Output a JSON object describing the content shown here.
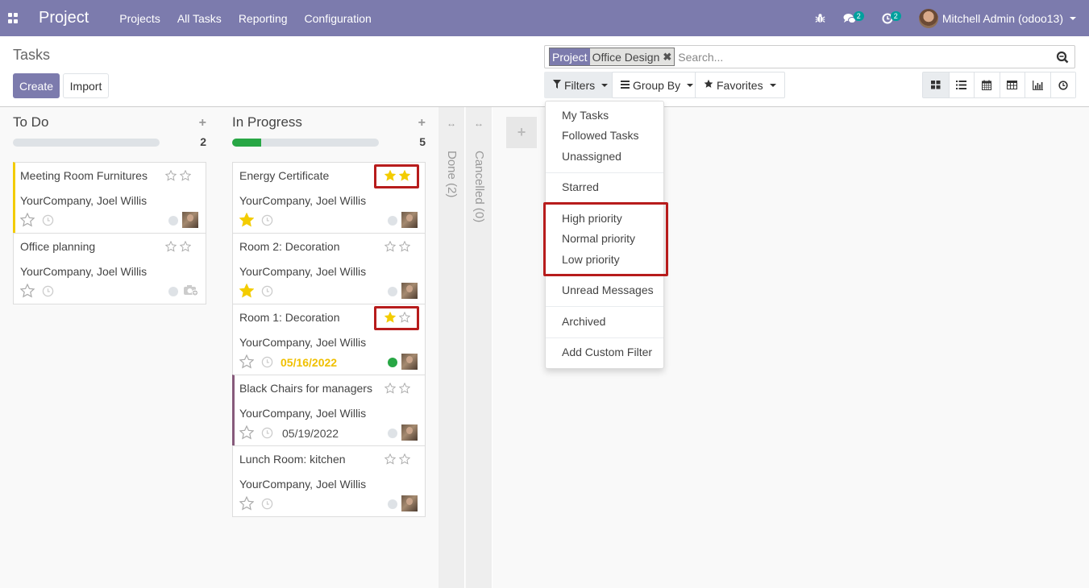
{
  "navbar": {
    "app_name": "Project",
    "menu": [
      "Projects",
      "All Tasks",
      "Reporting",
      "Configuration"
    ],
    "messages_count": "2",
    "activities_count": "2",
    "user": "Mitchell Admin (odoo13)"
  },
  "control": {
    "title": "Tasks",
    "create_label": "Create",
    "import_label": "Import",
    "search": {
      "facet_category": "Project",
      "facet_value": "Office Design",
      "placeholder": "Search..."
    },
    "filters_label": "Filters",
    "groupby_label": "Group By",
    "favorites_label": "Favorites",
    "views": [
      "kanban",
      "list",
      "calendar",
      "pivot",
      "graph",
      "activity"
    ]
  },
  "kanban": {
    "columns": [
      {
        "title": "To Do",
        "count": "2",
        "progress_green_fraction": 0,
        "cards": [
          {
            "title": "Meeting Room Furnitures",
            "subtitle": "YourCompany, Joel Willis",
            "priority": 0,
            "starred": false,
            "deadline": "",
            "state": "normal"
          },
          {
            "title": "Office planning",
            "subtitle": "YourCompany, Joel Willis",
            "priority": 0,
            "starred": false,
            "deadline": "",
            "state": "normal"
          }
        ]
      },
      {
        "title": "In Progress",
        "count": "5",
        "progress_green_fraction": 0.2,
        "cards": [
          {
            "title": "Energy Certificate",
            "subtitle": "YourCompany, Joel Willis",
            "priority": 2,
            "starred": true,
            "deadline": "",
            "state": "normal"
          },
          {
            "title": "Room 2: Decoration",
            "subtitle": "YourCompany, Joel Willis",
            "priority": 0,
            "starred": true,
            "deadline": "",
            "state": "normal"
          },
          {
            "title": "Room 1: Decoration",
            "subtitle": "YourCompany, Joel Willis",
            "priority": 1,
            "starred": false,
            "deadline": "05/16/2022",
            "state": "done"
          },
          {
            "title": "Black Chairs for managers",
            "subtitle": "YourCompany, Joel Willis",
            "priority": 0,
            "starred": false,
            "deadline": "05/19/2022",
            "state": "normal"
          },
          {
            "title": "Lunch Room: kitchen",
            "subtitle": "YourCompany, Joel Willis",
            "priority": 0,
            "starred": false,
            "deadline": "",
            "state": "normal"
          }
        ]
      }
    ],
    "folded_columns": [
      "Done (2)",
      "Cancelled (0)"
    ]
  },
  "filters_dropdown": {
    "items": [
      "My Tasks",
      "Followed Tasks",
      "Unassigned",
      "Starred",
      "High priority",
      "Normal priority",
      "Low priority",
      "Unread Messages",
      "Archived",
      "Add Custom Filter"
    ]
  },
  "colors": {
    "brand": "#7c7bad",
    "star": "#f3cc00",
    "highlight": "#b71c1c",
    "progress": "#28a745"
  }
}
